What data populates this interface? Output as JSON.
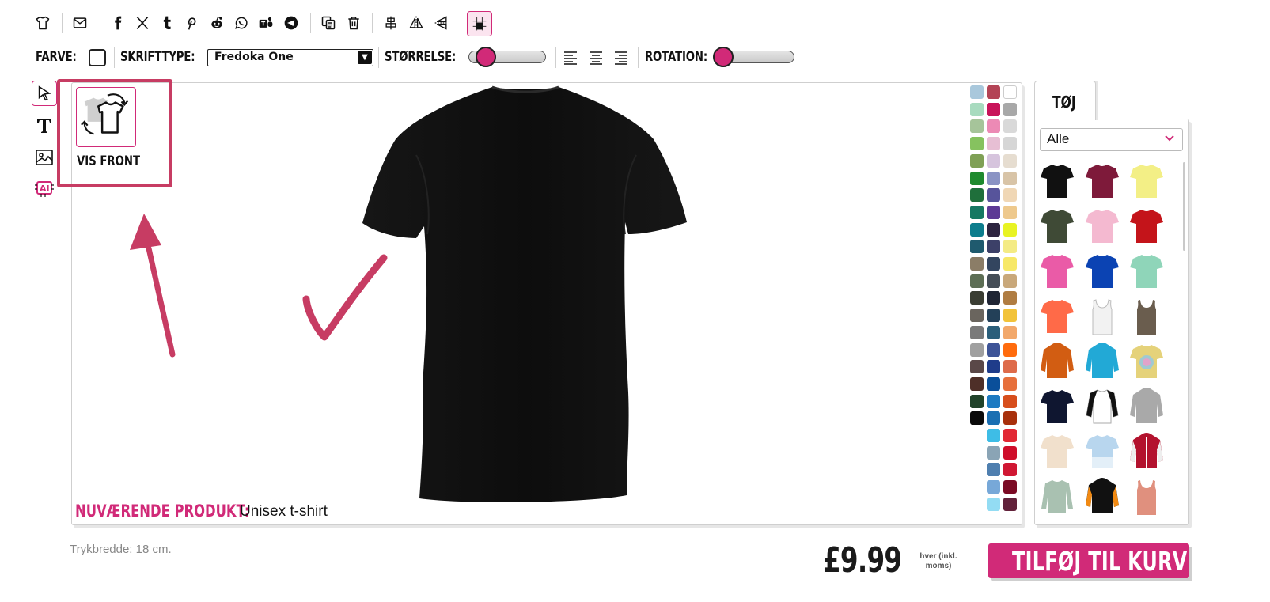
{
  "toolbar": {
    "icons": [
      "tshirt-icon",
      "envelope-icon",
      "facebook-icon",
      "x-twitter-icon",
      "tumblr-icon",
      "pinterest-icon",
      "reddit-icon",
      "whatsapp-icon",
      "teams-icon",
      "telegram-icon",
      "copy-icon",
      "trash-icon",
      "align-center-icon",
      "flip-horizontal-icon",
      "flip-vertical-icon",
      "grid-toggle-icon"
    ]
  },
  "format_bar": {
    "color_label": "FARVE:",
    "font_label": "SKRIFTTYPE:",
    "font_value": "Fredoka One",
    "size_label": "STØRRELSE:",
    "size_level": 0.2,
    "rotation_label": "ROTATION:",
    "rotation_level": 0.0
  },
  "left_tools": [
    "pointer-icon",
    "text-tool-icon",
    "image-tool-icon",
    "ai-tool-icon"
  ],
  "canvas": {
    "vis_front_label": "VIS FRONT",
    "current_product_label": "NUVÆRENDE PRODUKT:",
    "current_product_value": "Unisex t-shirt"
  },
  "palette": {
    "col1": [
      "#a9c8dc",
      "#a8dbbf",
      "#a6c49a",
      "#86c25f",
      "#7fa055",
      "#1e8a2e",
      "#1f6f3b",
      "#167862",
      "#0d7d8d",
      "#1f5a6e",
      "#8b7d67",
      "#5d6e55",
      "#3a3d33",
      "#6a655e",
      "#7a7a7a",
      "#a0a0a0",
      "#5a4848",
      "#4e2f28",
      "#21432a",
      "#0a0a0a"
    ],
    "col2": [
      "#b34456",
      "#c8145a",
      "#ec8ab5",
      "#e7bfd4",
      "#d6c4dd",
      "#8a93c4",
      "#57549b",
      "#5d3a95",
      "#2e2540",
      "#3c4068",
      "#33455f",
      "#454e57",
      "#1f2534",
      "#234058",
      "#2a5e7a",
      "#3e5497",
      "#1f3c8a",
      "#0a4f9a",
      "#1e7bc2",
      "#1a6fb2",
      "#3ebde6",
      "#8aa4b5",
      "#4f7faf",
      "#77a8d8",
      "#93dcf3"
    ],
    "col3": [
      "#ffffff",
      "#a8a8a8",
      "#d9d9d9",
      "#d6d6d6",
      "#e6ddd0",
      "#d8c4a7",
      "#f0d7b5",
      "#eec98d",
      "#e8f324",
      "#f4eb84",
      "#f7e867",
      "#c9a87a",
      "#b07d42",
      "#f2c33a",
      "#f2a86b",
      "#ff6b0d",
      "#de6b4a",
      "#e7703c",
      "#d74e1c",
      "#a8300c",
      "#e22834",
      "#cf0d2a",
      "#d01733",
      "#7b0a24",
      "#62213a"
    ]
  },
  "side_panel": {
    "tab_label": "TØJ",
    "category_value": "Alle",
    "products": [
      {
        "name": "black-tshirt",
        "color": "#111111",
        "kind": "tee"
      },
      {
        "name": "maroon-tshirt",
        "color": "#7e1a3a",
        "kind": "tee"
      },
      {
        "name": "yellow-tshirt",
        "color": "#f3ef86",
        "kind": "tee"
      },
      {
        "name": "olive-tshirt",
        "color": "#3f4a36",
        "kind": "tee"
      },
      {
        "name": "pink-tshirt",
        "color": "#f4b9d0",
        "kind": "tee"
      },
      {
        "name": "red-tshirt",
        "color": "#c4141a",
        "kind": "tee"
      },
      {
        "name": "magenta-tshirt",
        "color": "#ea5ba7",
        "kind": "tee"
      },
      {
        "name": "royal-blue-tshirt",
        "color": "#0b43b3",
        "kind": "tee"
      },
      {
        "name": "mint-tshirt",
        "color": "#8fd5b9",
        "kind": "tee"
      },
      {
        "name": "coral-tshirt",
        "color": "#ff6a48",
        "kind": "tee"
      },
      {
        "name": "white-tanktop",
        "color": "#f2f2f2",
        "kind": "tank"
      },
      {
        "name": "brown-tanktop",
        "color": "#6a5d4e",
        "kind": "tank"
      },
      {
        "name": "orange-hoodie",
        "color": "#d25d12",
        "kind": "hoodie"
      },
      {
        "name": "turquoise-hoodie",
        "color": "#22a9d6",
        "kind": "hoodie"
      },
      {
        "name": "tie-dye-tshirt",
        "color": "#e5d27a",
        "kind": "tee"
      },
      {
        "name": "navy-tshirt",
        "color": "#0f1630",
        "kind": "tee"
      },
      {
        "name": "raglan-tshirt",
        "color": "#ffffff",
        "kind": "raglan"
      },
      {
        "name": "grey-hoodie",
        "color": "#a9a9a9",
        "kind": "hoodie"
      },
      {
        "name": "cream-tshirt",
        "color": "#f1e0cc",
        "kind": "tee"
      },
      {
        "name": "gradient-tshirt",
        "color": "#b8d6ee",
        "kind": "tee"
      },
      {
        "name": "varsity-jacket",
        "color": "#b3122e",
        "kind": "jacket"
      },
      {
        "name": "sage-longsleeve",
        "color": "#a9c1b1",
        "kind": "long"
      },
      {
        "name": "black-orange-hoodie",
        "color": "#111111",
        "kind": "hoodie"
      },
      {
        "name": "salmon-tanktop",
        "color": "#e0907e",
        "kind": "tank"
      }
    ]
  },
  "footer": {
    "print_width": "Trykbredde: 18 cm.",
    "price": "£9.99",
    "price_note": "hver (inkl. moms)",
    "add_to_cart": "TILFØJ TIL KURV"
  },
  "colors": {
    "accent": "#d12a78",
    "annotation": "#c73c63"
  }
}
